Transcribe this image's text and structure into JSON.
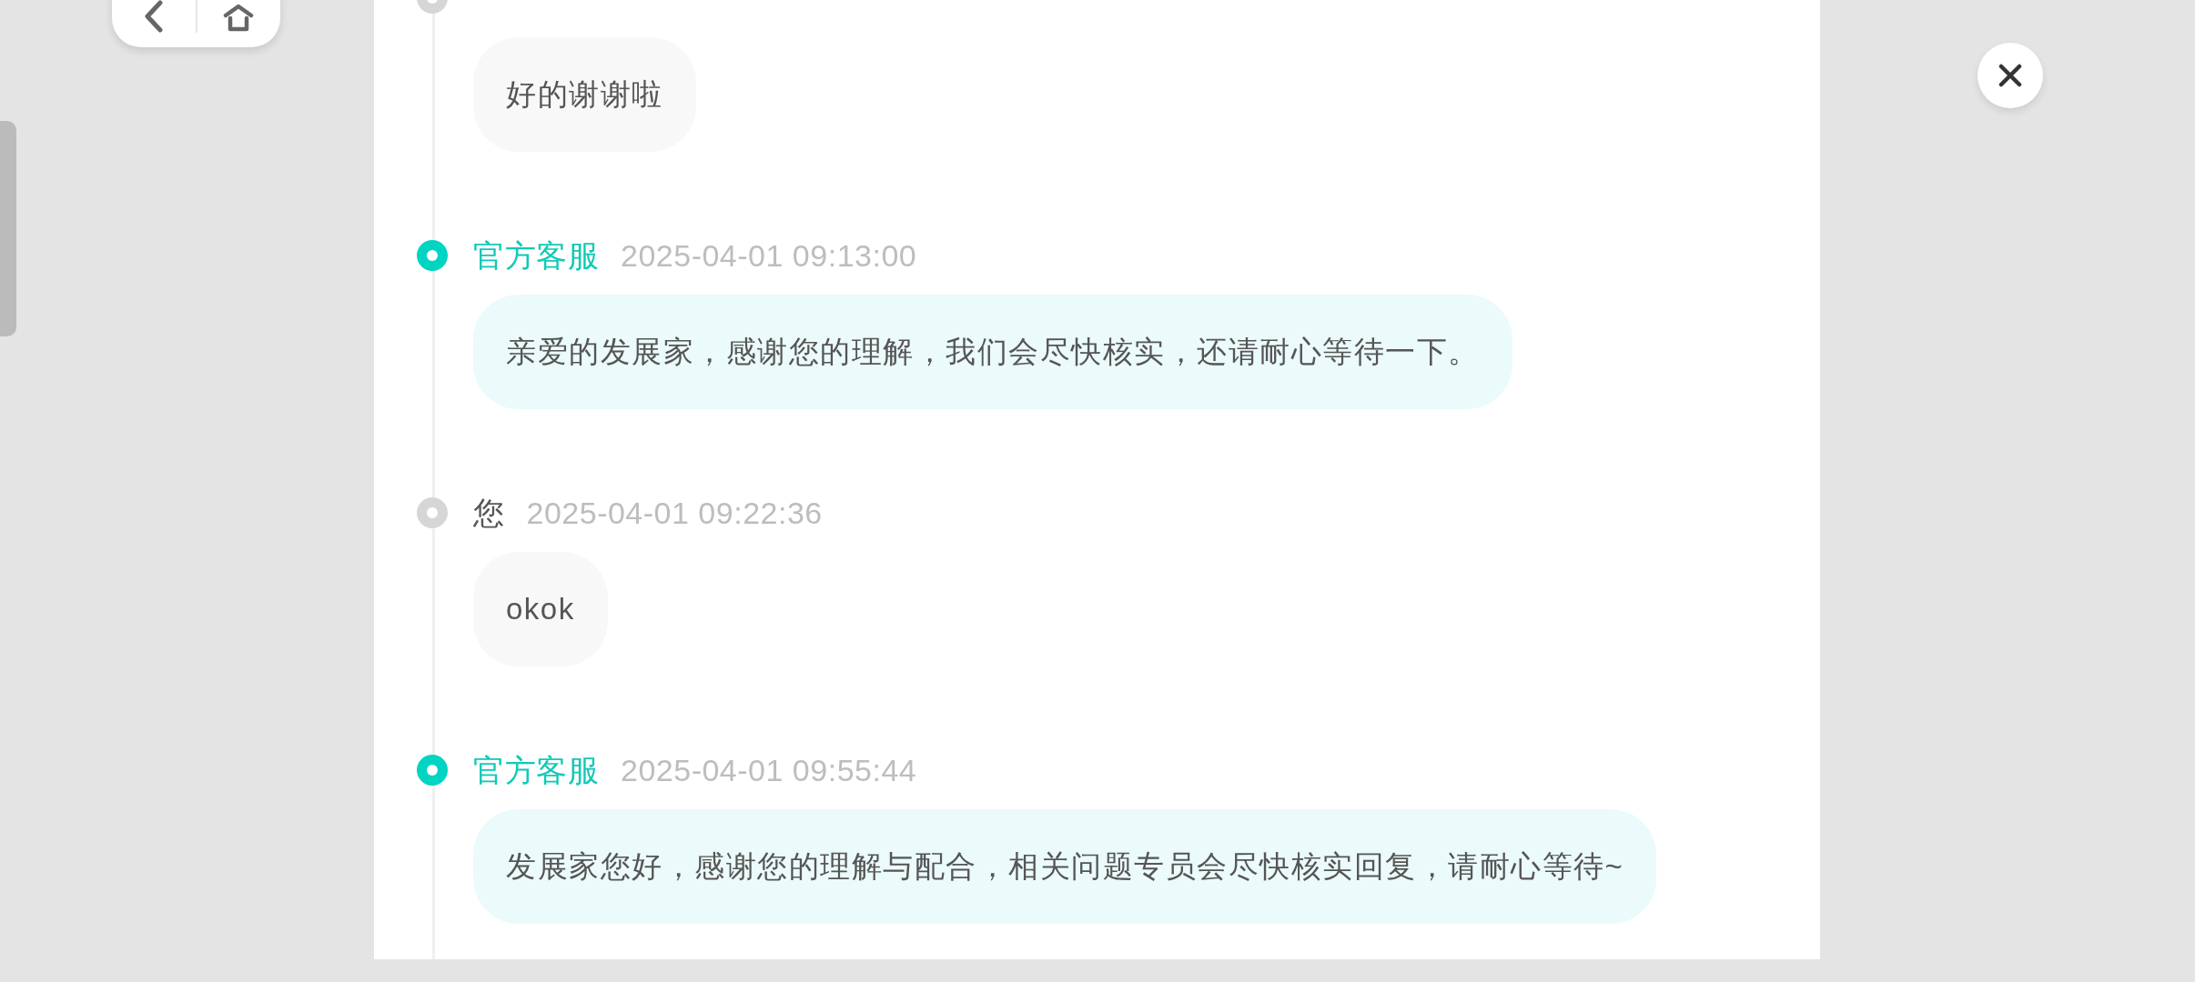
{
  "messages": [
    {
      "kind": "user",
      "text": "好的谢谢啦"
    },
    {
      "kind": "agent",
      "sender": "官方客服",
      "time": "2025-04-01 09:13:00",
      "text": "亲爱的发展家，感谢您的理解，我们会尽快核实，还请耐心等待一下。"
    },
    {
      "kind": "user",
      "sender": "您",
      "time": "2025-04-01 09:22:36",
      "text": "okok"
    },
    {
      "kind": "agent",
      "sender": "官方客服",
      "time": "2025-04-01 09:55:44",
      "text": "发展家您好，感谢您的理解与配合，相关问题专员会尽快核实回复，请耐心等待~"
    }
  ]
}
